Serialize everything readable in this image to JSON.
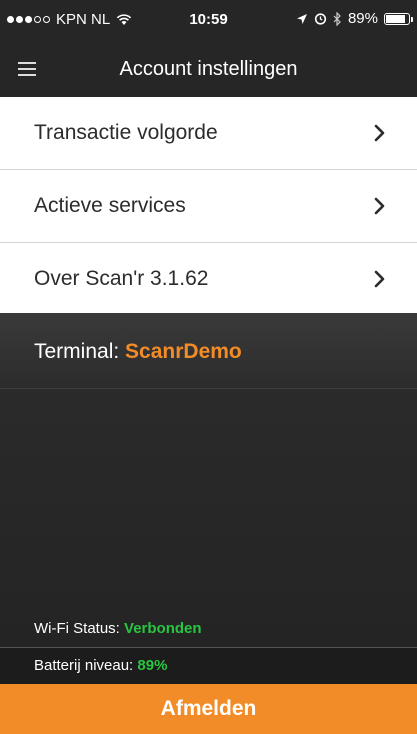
{
  "status_bar": {
    "carrier": "KPN NL",
    "time": "10:59",
    "battery_percent": "89%",
    "battery_level": 0.89,
    "icons": [
      "signal-dots-icon",
      "wifi-icon",
      "location-icon",
      "alarm-icon",
      "bluetooth-icon",
      "battery-icon"
    ]
  },
  "header": {
    "title": "Account instellingen",
    "menu_icon": "hamburger-icon"
  },
  "menu": {
    "items": [
      {
        "label": "Transactie volgorde",
        "icon": "chevron-right-icon"
      },
      {
        "label": "Actieve services",
        "icon": "chevron-right-icon"
      },
      {
        "label": "Over Scan'r 3.1.62",
        "icon": "chevron-right-icon"
      }
    ]
  },
  "terminal": {
    "label": "Terminal:",
    "value": "ScanrDemo"
  },
  "wifi": {
    "label": "Wi-Fi Status:",
    "value": "Verbonden"
  },
  "battery": {
    "label": "Batterij niveau:",
    "value": "89%"
  },
  "logout": {
    "label": "Afmelden"
  },
  "colors": {
    "accent": "#f28c28",
    "status_ok": "#29c540",
    "header_bg": "#262626"
  }
}
